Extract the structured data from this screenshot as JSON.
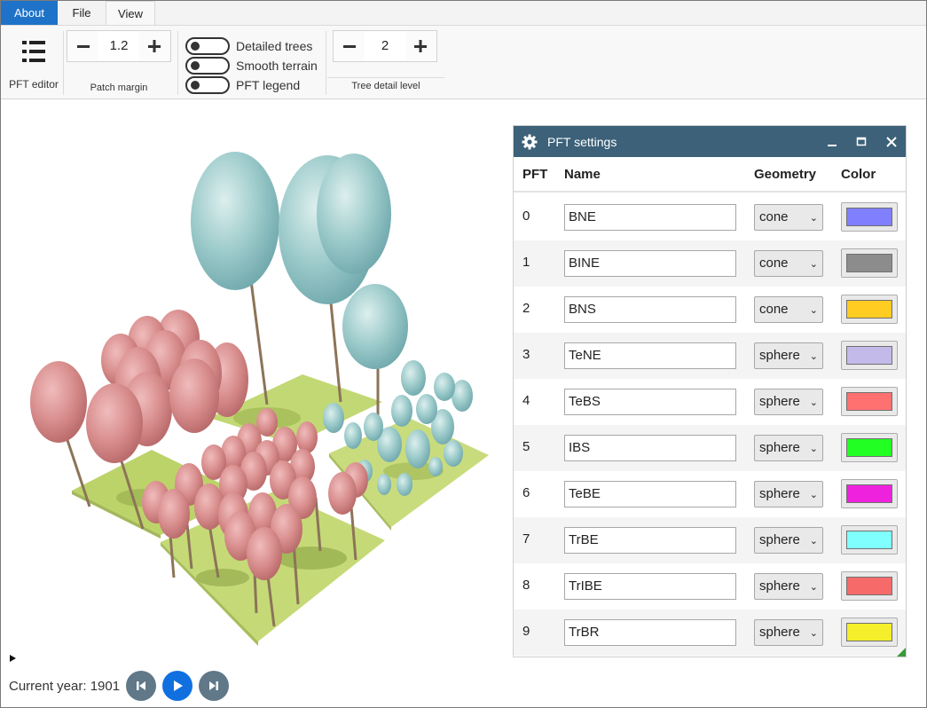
{
  "tabs": [
    "About",
    "File",
    "View"
  ],
  "ribbon": {
    "pft_editor_label": "PFT editor",
    "patch_margin": {
      "value": "1.2",
      "label": "Patch margin"
    },
    "toggles": [
      {
        "label": "Detailed trees",
        "on": false
      },
      {
        "label": "Smooth terrain",
        "on": false
      },
      {
        "label": "PFT legend",
        "on": false
      }
    ],
    "tree_detail": {
      "value": "2",
      "label": "Tree detail level"
    }
  },
  "pft_panel": {
    "title": "PFT settings",
    "headers": {
      "pft": "PFT",
      "name": "Name",
      "geometry": "Geometry",
      "color": "Color"
    },
    "rows": [
      {
        "id": "0",
        "name": "BNE",
        "geometry": "cone",
        "color": "#8080ff"
      },
      {
        "id": "1",
        "name": "BINE",
        "geometry": "cone",
        "color": "#8c8c8c"
      },
      {
        "id": "2",
        "name": "BNS",
        "geometry": "cone",
        "color": "#ffcc22"
      },
      {
        "id": "3",
        "name": "TeNE",
        "geometry": "sphere",
        "color": "#c4baea"
      },
      {
        "id": "4",
        "name": "TeBS",
        "geometry": "sphere",
        "color": "#ff7070"
      },
      {
        "id": "5",
        "name": "IBS",
        "geometry": "sphere",
        "color": "#22ff22"
      },
      {
        "id": "6",
        "name": "TeBE",
        "geometry": "sphere",
        "color": "#ee22dd"
      },
      {
        "id": "7",
        "name": "TrBE",
        "geometry": "sphere",
        "color": "#80ffff"
      },
      {
        "id": "8",
        "name": "TrIBE",
        "geometry": "sphere",
        "color": "#f76a6a"
      },
      {
        "id": "9",
        "name": "TrBR",
        "geometry": "sphere",
        "color": "#f5ee2a"
      }
    ]
  },
  "playback": {
    "current_year_text": "Current year: 1901"
  },
  "colors": {
    "accent": "#1e73c8",
    "panel_title_bg": "#3c6179",
    "play_button": "#1070e0",
    "nav_button": "#607888",
    "terrain": "#bcd46a",
    "tree_teal": "#8ec6c6",
    "tree_pink": "#d88c8c"
  },
  "icons": [
    "list-icon",
    "minus-icon",
    "plus-icon",
    "gear-icon",
    "minimize-icon",
    "maximize-icon",
    "close-icon",
    "chevron-down-icon",
    "skip-back-icon",
    "play-icon",
    "skip-forward-icon",
    "expand-arrow-icon",
    "resize-grip-icon"
  ]
}
